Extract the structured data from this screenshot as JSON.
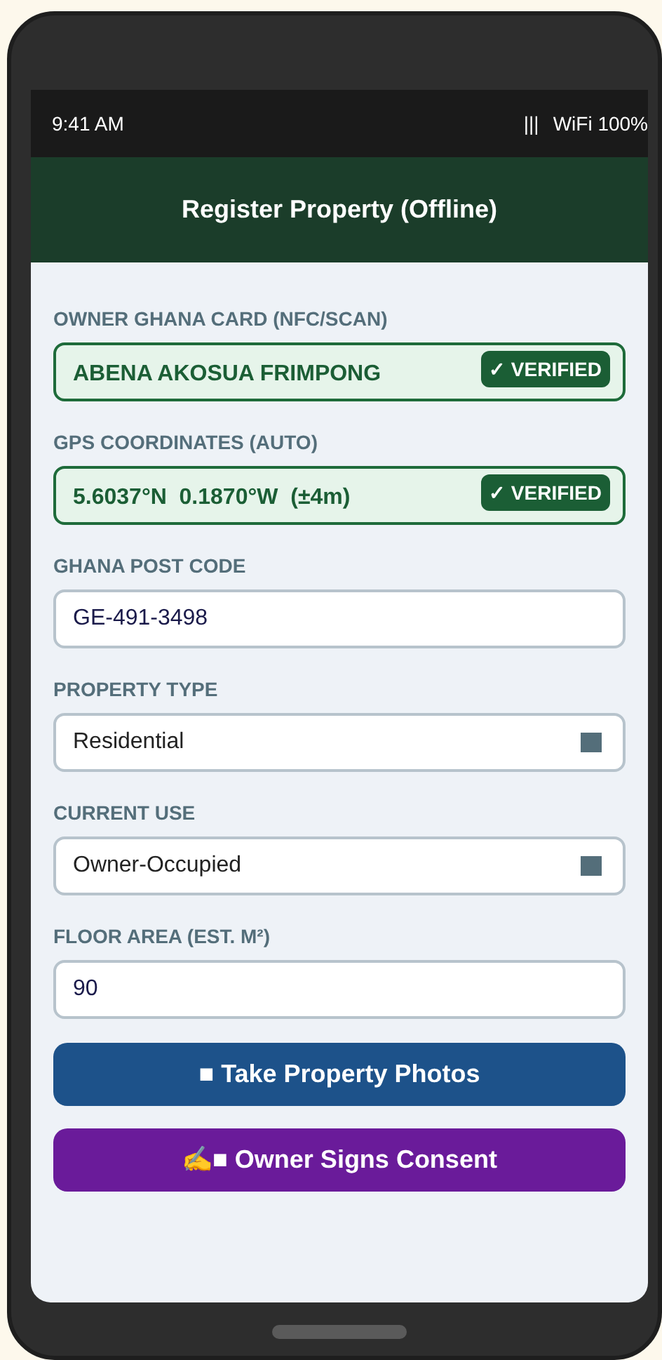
{
  "status_bar": {
    "time": "9:41 AM",
    "signal": "|||",
    "network": "WiFi 100%"
  },
  "header": {
    "title": "Register Property (Offline)"
  },
  "fields": [
    {
      "kind": "verified",
      "label": "OWNER GHANA CARD (NFC/SCAN)",
      "value": "ABENA AKOSUA FRIMPONG",
      "badge": "✓ VERIFIED"
    },
    {
      "kind": "verified",
      "label": "GPS COORDINATES (AUTO)",
      "value": "5.6037°N  0.1870°W  (±4m)",
      "badge": "✓ VERIFIED"
    },
    {
      "kind": "input",
      "label": "GHANA POST CODE",
      "value": "GE-491-3498"
    },
    {
      "kind": "select",
      "label": "PROPERTY TYPE",
      "value": "Residential"
    },
    {
      "kind": "select",
      "label": "CURRENT USE",
      "value": "Owner-Occupied"
    },
    {
      "kind": "input",
      "label": "FLOOR AREA (EST. M²)",
      "value": "90"
    }
  ],
  "buttons": [
    {
      "kind": "photos",
      "label": "■ Take Property Photos"
    },
    {
      "kind": "consent",
      "label": "✍■ Owner Signs Consent"
    }
  ]
}
